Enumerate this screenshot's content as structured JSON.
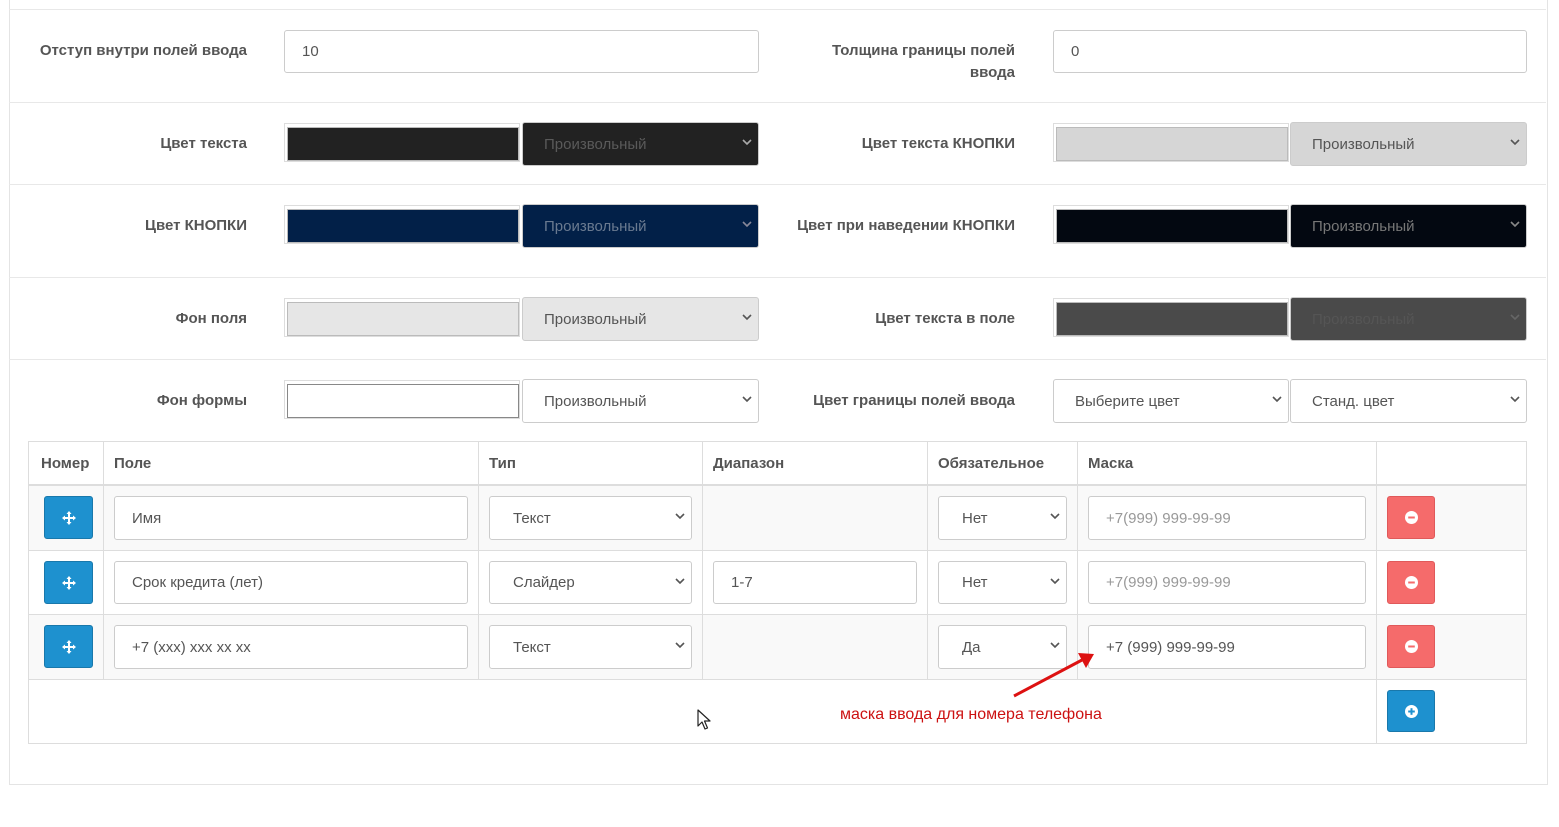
{
  "settings": {
    "padding_label": "Отступ внутри полей ввода",
    "padding_value": "10",
    "border_width_label": "Толщина границы полей ввода",
    "border_width_value": "0",
    "text_color_label": "Цвет текста",
    "text_color_select": "Произвольный",
    "text_color_hex": "#222222",
    "button_text_color_label": "Цвет текста КНОПКИ",
    "button_text_color_select": "Произвольный",
    "button_text_color_hex": "#d6d6d6",
    "button_color_label": "Цвет КНОПКИ",
    "button_color_select": "Произвольный",
    "button_color_hex": "#022048",
    "button_hover_label": "Цвет при наведении КНОПКИ",
    "button_hover_select": "Произвольный",
    "button_hover_hex": "#030811",
    "field_bg_label": "Фон поля",
    "field_bg_select": "Произвольный",
    "field_bg_hex": "#e6e6e6",
    "field_text_color_label": "Цвет текста в поле",
    "field_text_color_select": "Произвольный",
    "field_text_color_hex": "#4a4a4a",
    "form_bg_label": "Фон формы",
    "form_bg_select": "Произвольный",
    "form_bg_hex": "#ffffff",
    "border_color_label": "Цвет границы полей ввода",
    "border_color_select": "Выберите цвет",
    "border_color_std_select": "Станд. цвет"
  },
  "table": {
    "headers": [
      "Номер",
      "Поле",
      "Тип",
      "Диапазон",
      "Обязательное",
      "Маска"
    ],
    "rows": [
      {
        "field": "Имя",
        "type": "Текст",
        "range": "",
        "required": "Нет",
        "mask": "",
        "mask_placeholder": "+7(999) 999-99-99"
      },
      {
        "field": "Срок кредита (лет)",
        "type": "Слайдер",
        "range": "1-7",
        "required": "Нет",
        "mask": "",
        "mask_placeholder": "+7(999) 999-99-99"
      },
      {
        "field": "+7 (xxx) xxx xx xx",
        "type": "Текст",
        "range": "",
        "required": "Да",
        "mask": "+7 (999) 999-99-99",
        "mask_placeholder": "+7(999) 999-99-99"
      }
    ]
  },
  "annotation": {
    "text": "маска ввода для номера телефона",
    "color": "#cc1111"
  },
  "colors": {
    "accent_blue": "#1e91cf",
    "danger_red": "#f56b6b"
  }
}
